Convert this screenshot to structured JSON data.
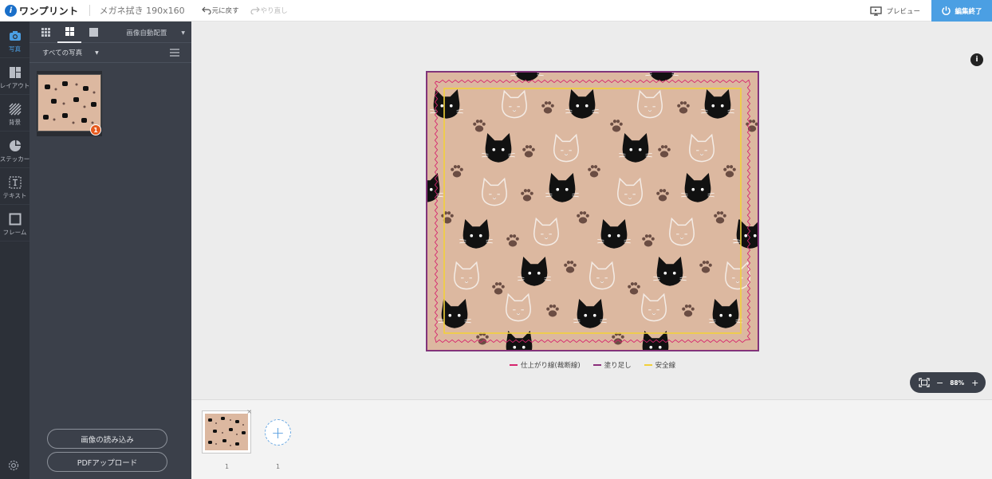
{
  "app": {
    "logo_text": "ワンプリント",
    "logo_mark": "i",
    "doc_title": "メガネ拭き 190x160"
  },
  "toolbar": {
    "undo_label": "元に戻す",
    "redo_label": "やり直し",
    "preview_label": "プレビュー",
    "finish_label": "編集終了"
  },
  "rail": {
    "items": [
      {
        "label": "写真",
        "icon": "camera-icon"
      },
      {
        "label": "レイアウト",
        "icon": "layout-icon"
      },
      {
        "label": "背景",
        "icon": "background-icon"
      },
      {
        "label": "ステッカー",
        "icon": "sticker-icon"
      },
      {
        "label": "テキスト",
        "icon": "text-icon"
      },
      {
        "label": "フレーム",
        "icon": "frame-icon"
      }
    ]
  },
  "panel": {
    "auto_layout_label": "画像自動配置",
    "filter_label": "すべての写真",
    "thumb_badge": "1",
    "load_images_label": "画像の読み込み",
    "pdf_upload_label": "PDFアップロード"
  },
  "canvas": {
    "info_label": "i",
    "legend": [
      {
        "label": "仕上がり線(裁断線)",
        "color": "#d6246e"
      },
      {
        "label": "塗り足し",
        "color": "#8a2e7a"
      },
      {
        "label": "安全線",
        "color": "#f2d03a"
      }
    ],
    "zoom_level": "88%",
    "zoom_minus": "−",
    "zoom_plus": "+"
  },
  "pages": {
    "add_label": "+",
    "delete_label": "×",
    "page_numbers": [
      "1",
      "1"
    ]
  },
  "colors": {
    "accent": "#4b9fe3",
    "pattern_bg": "#dcb8a0",
    "badge": "#e65a1e"
  }
}
